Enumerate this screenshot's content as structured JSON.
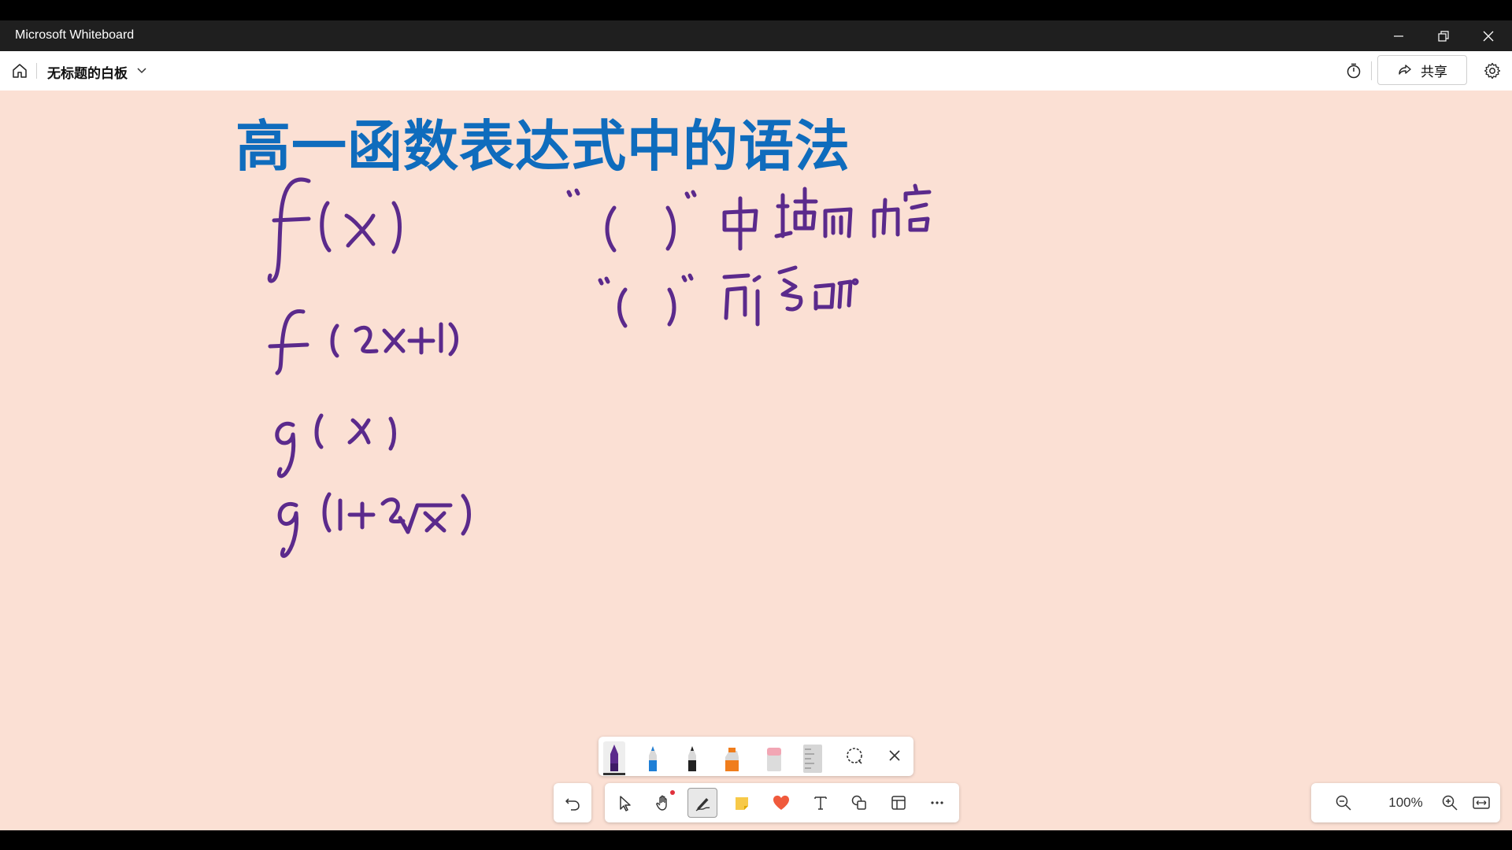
{
  "window": {
    "app_title": "Microsoft Whiteboard",
    "minimize_icon": "minimize-icon",
    "restore_icon": "restore-icon",
    "close_icon": "close-icon"
  },
  "appbar": {
    "board_title": "无标题的白板",
    "share_label": "共享",
    "icons": [
      "home-icon",
      "chevron-down-icon",
      "timer-icon",
      "share-icon",
      "gear-icon"
    ]
  },
  "canvas": {
    "background": "#fbe0d4",
    "heading": "高一函数表达式中的语法",
    "heading_color": "#0f6cbd",
    "ink_color": "#5b2a8c",
    "handwriting": [
      "f(x)",
      "f(2x+1)",
      "g(x)",
      "g(1+2√x)",
      "“( )”中填的内容",
      "“( )”所写的"
    ]
  },
  "pen_tray": {
    "tools": [
      "purple-pen",
      "blue-pen",
      "black-pen",
      "orange-highlighter",
      "eraser",
      "ruler",
      "lasso-select",
      "close-tray"
    ],
    "active_color": "#5b2a8c"
  },
  "toolbar": {
    "undo": "undo-icon",
    "tools": [
      "select-icon",
      "pan-hand-icon",
      "ink-pen-icon",
      "sticky-note-icon",
      "reactions-heart-icon",
      "text-icon",
      "shapes-icon",
      "templates-icon",
      "more-icon"
    ]
  },
  "zoom": {
    "level": "100%"
  }
}
